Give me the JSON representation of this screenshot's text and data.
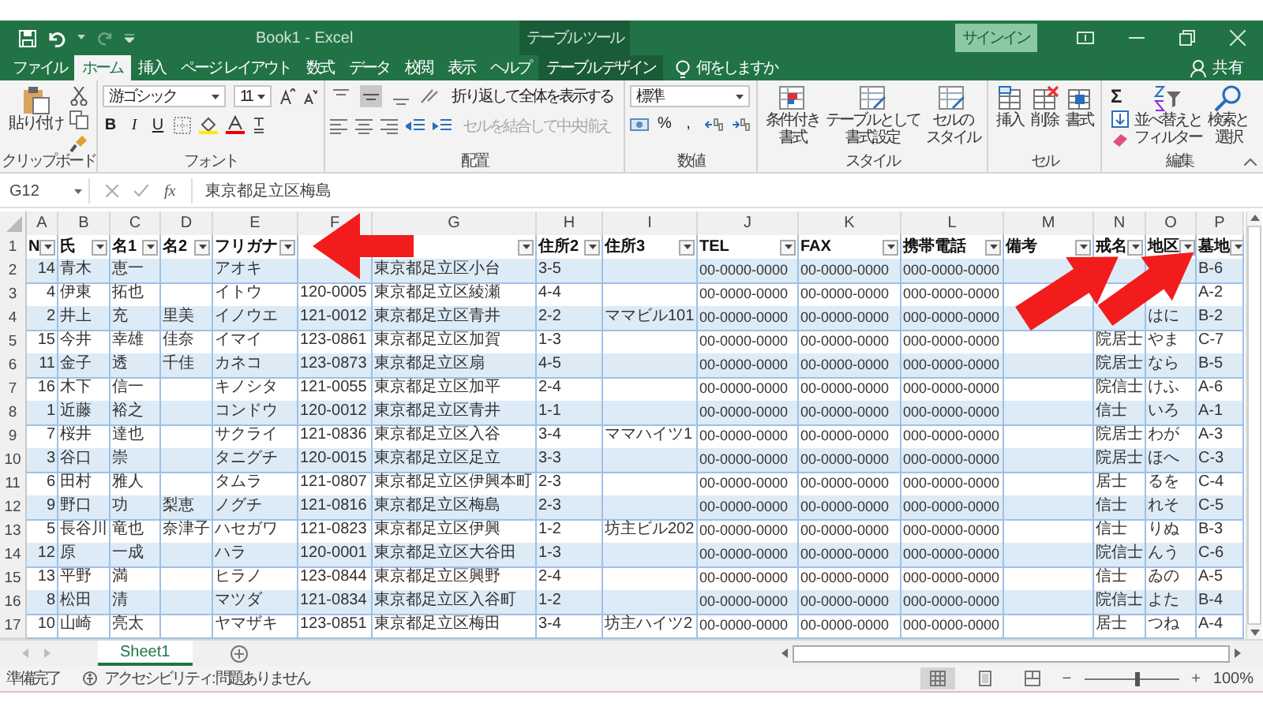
{
  "title_bar": {
    "title": "Book1  -  Excel",
    "context_title": "テーブル ツール",
    "sign_in": "サインイン"
  },
  "ribbon_tabs": [
    {
      "label": "ファイル",
      "selected": false,
      "contextual": false
    },
    {
      "label": "ホーム",
      "selected": true,
      "contextual": false
    },
    {
      "label": "挿入",
      "selected": false,
      "contextual": false
    },
    {
      "label": "ページ レイアウト",
      "selected": false,
      "contextual": false
    },
    {
      "label": "数式",
      "selected": false,
      "contextual": false
    },
    {
      "label": "データ",
      "selected": false,
      "contextual": false
    },
    {
      "label": "校閲",
      "selected": false,
      "contextual": false
    },
    {
      "label": "表示",
      "selected": false,
      "contextual": false
    },
    {
      "label": "ヘルプ",
      "selected": false,
      "contextual": false
    },
    {
      "label": "テーブル デザイン",
      "selected": false,
      "contextual": true
    }
  ],
  "tell_me": "何をしますか",
  "share": "共有",
  "ribbon": {
    "clipboard": {
      "paste": "貼り付け",
      "label": "クリップボード"
    },
    "font": {
      "name": "游ゴシック",
      "size": "11",
      "bold": "B",
      "italic": "I",
      "underline": "U",
      "label": "フォント"
    },
    "alignment": {
      "vertical": [
        {
          "kind": "top",
          "selected": false
        },
        {
          "kind": "middle",
          "selected": true
        },
        {
          "kind": "bottom",
          "selected": false
        }
      ],
      "wrap": "折り返して全体を表示する",
      "merge": {
        "label": "セルを結合して中央揃え",
        "disabled": true
      },
      "label": "配置"
    },
    "number": {
      "format": "標準",
      "percent": "%",
      "comma": ",",
      "label": "数値"
    },
    "styles": {
      "buttons": [
        {
          "lines": [
            "条件付き",
            "書式"
          ]
        },
        {
          "lines": [
            "テーブルとして",
            "書式設定"
          ]
        },
        {
          "lines": [
            "セルの",
            "スタイル"
          ]
        }
      ],
      "label": "スタイル"
    },
    "cells": {
      "buttons": [
        "挿入",
        "削除",
        "書式"
      ],
      "label": "セル"
    },
    "editing": {
      "sum": "Σ",
      "buttons": [
        {
          "lines": [
            "並べ替えと",
            "フィルター"
          ]
        },
        {
          "lines": [
            "検索と",
            "選択"
          ]
        }
      ],
      "label": "編集"
    }
  },
  "formula_bar": {
    "name_box": "G12",
    "function": "fx",
    "formula": "東京都足立区梅島"
  },
  "sheet": {
    "columns": [
      "A",
      "B",
      "C",
      "D",
      "E",
      "F",
      "G",
      "H",
      "I",
      "J",
      "K",
      "L",
      "M",
      "N",
      "O",
      "P"
    ],
    "header": {
      "n": "1",
      "cells": [
        {
          "label": "N",
          "filter": true
        },
        {
          "label": "氏",
          "filter": true
        },
        {
          "label": "名1",
          "filter": true
        },
        {
          "label": "名2",
          "filter": true
        },
        {
          "label": "フリガナ",
          "filter": true
        },
        null,
        {
          "filter": true
        },
        {
          "label": "住所2",
          "filter": true
        },
        {
          "label": "住所3",
          "filter": true
        },
        {
          "label": "TEL",
          "filter": true
        },
        {
          "label": "FAX",
          "filter": true
        },
        {
          "label": "携帯電話",
          "filter": true
        },
        {
          "label": "備考",
          "filter": true
        },
        {
          "label": "戒名",
          "filter": true
        },
        {
          "label": "地区",
          "filter": true
        },
        {
          "label": "墓地",
          "filter": true
        }
      ]
    },
    "rows": [
      {
        "n": "2",
        "cells": [
          "14",
          "青木",
          "恵一",
          null,
          "アオキ",
          null,
          "東京都足立区小台",
          "3-5",
          null,
          "00-0000-0000",
          "00-0000-0000",
          "000-0000-0000",
          null,
          null,
          null,
          "B-6"
        ]
      },
      {
        "n": "3",
        "cells": [
          "4",
          "伊東",
          "拓也",
          null,
          "イトウ",
          "120-0005",
          "東京都足立区綾瀬",
          "4-4",
          null,
          "00-0000-0000",
          "00-0000-0000",
          "000-0000-0000",
          null,
          null,
          null,
          "A-2"
        ]
      },
      {
        "n": "4",
        "cells": [
          "2",
          "井上",
          "充",
          "里美",
          "イノウエ",
          "121-0012",
          "東京都足立区青井",
          "2-2",
          "ママビル101",
          "00-0000-0000",
          "00-0000-0000",
          "000-0000-0000",
          null,
          null,
          "はに",
          "B-2"
        ]
      },
      {
        "n": "5",
        "cells": [
          "15",
          "今井",
          "幸雄",
          "佳奈",
          "イマイ",
          "123-0861",
          "東京都足立区加賀",
          "1-3",
          null,
          "00-0000-0000",
          "00-0000-0000",
          "000-0000-0000",
          null,
          "院居士",
          "やま",
          "C-7"
        ]
      },
      {
        "n": "6",
        "cells": [
          "11",
          "金子",
          "透",
          "千佳",
          "カネコ",
          "123-0873",
          "東京都足立区扇",
          "4-5",
          null,
          "00-0000-0000",
          "00-0000-0000",
          "000-0000-0000",
          null,
          "院居士",
          "なら",
          "B-5"
        ]
      },
      {
        "n": "7",
        "cells": [
          "16",
          "木下",
          "信一",
          null,
          "キノシタ",
          "121-0055",
          "東京都足立区加平",
          "2-4",
          null,
          "00-0000-0000",
          "00-0000-0000",
          "000-0000-0000",
          null,
          "院信士",
          "けふ",
          "A-6"
        ]
      },
      {
        "n": "8",
        "cells": [
          "1",
          "近藤",
          "裕之",
          null,
          "コンドウ",
          "120-0012",
          "東京都足立区青井",
          "1-1",
          null,
          "00-0000-0000",
          "00-0000-0000",
          "000-0000-0000",
          null,
          "信士",
          "いろ",
          "A-1"
        ]
      },
      {
        "n": "9",
        "cells": [
          "7",
          "桜井",
          "達也",
          null,
          "サクライ",
          "121-0836",
          "東京都足立区入谷",
          "3-4",
          "ママハイツ1",
          "00-0000-0000",
          "00-0000-0000",
          "000-0000-0000",
          null,
          "院居士",
          "わが",
          "A-3"
        ]
      },
      {
        "n": "10",
        "cells": [
          "3",
          "谷口",
          "崇",
          null,
          "タニグチ",
          "120-0015",
          "東京都足立区足立",
          "3-3",
          null,
          "00-0000-0000",
          "00-0000-0000",
          "000-0000-0000",
          null,
          "院居士",
          "ほへ",
          "C-3"
        ]
      },
      {
        "n": "11",
        "cells": [
          "6",
          "田村",
          "雅人",
          null,
          "タムラ",
          "121-0807",
          "東京都足立区伊興本町",
          "2-3",
          null,
          "00-0000-0000",
          "00-0000-0000",
          "000-0000-0000",
          null,
          "居士",
          "るを",
          "C-4"
        ]
      },
      {
        "n": "12",
        "cells": [
          "9",
          "野口",
          "功",
          "梨恵",
          "ノグチ",
          "121-0816",
          "東京都足立区梅島",
          "2-3",
          null,
          "00-0000-0000",
          "00-0000-0000",
          "000-0000-0000",
          null,
          "信士",
          "れそ",
          "C-5"
        ]
      },
      {
        "n": "13",
        "cells": [
          "5",
          "長谷川",
          "竜也",
          "奈津子",
          "ハセガワ",
          "121-0823",
          "東京都足立区伊興",
          "1-2",
          "坊主ビル202",
          "00-0000-0000",
          "00-0000-0000",
          "000-0000-0000",
          null,
          "信士",
          "りぬ",
          "B-3"
        ]
      },
      {
        "n": "14",
        "cells": [
          "12",
          "原",
          "一成",
          null,
          "ハラ",
          "120-0001",
          "東京都足立区大谷田",
          "1-3",
          null,
          "00-0000-0000",
          "00-0000-0000",
          "000-0000-0000",
          null,
          "院信士",
          "んう",
          "C-6"
        ]
      },
      {
        "n": "15",
        "cells": [
          "13",
          "平野",
          "満",
          null,
          "ヒラノ",
          "123-0844",
          "東京都足立区興野",
          "2-4",
          null,
          "00-0000-0000",
          "00-0000-0000",
          "000-0000-0000",
          null,
          "信士",
          "ゐの",
          "A-5"
        ]
      },
      {
        "n": "16",
        "cells": [
          "8",
          "松田",
          "清",
          null,
          "マツダ",
          "121-0834",
          "東京都足立区入谷町",
          "1-2",
          null,
          "00-0000-0000",
          "00-0000-0000",
          "000-0000-0000",
          null,
          "院信士",
          "よた",
          "B-4"
        ]
      },
      {
        "n": "17",
        "cells": [
          "10",
          "山崎",
          "亮太",
          null,
          "ヤマザキ",
          "123-0851",
          "東京都足立区梅田",
          "3-4",
          "坊主ハイツ2",
          "00-0000-0000",
          "00-0000-0000",
          "000-0000-0000",
          null,
          "居士",
          "つね",
          "A-4"
        ]
      }
    ]
  },
  "sheet_tabs": [
    {
      "label": "Sheet1",
      "selected": true
    }
  ],
  "status_bar": {
    "ready": "準備完了",
    "accessibility": "アクセシビリティ: 問題ありません",
    "view_buttons": [
      {
        "kind": "normal",
        "selected": true
      },
      {
        "kind": "page_layout",
        "selected": false
      },
      {
        "kind": "page_break",
        "selected": false
      }
    ],
    "zoom": {
      "level": 0.55,
      "minus": "−",
      "plus": "+",
      "percent": "100%"
    }
  }
}
